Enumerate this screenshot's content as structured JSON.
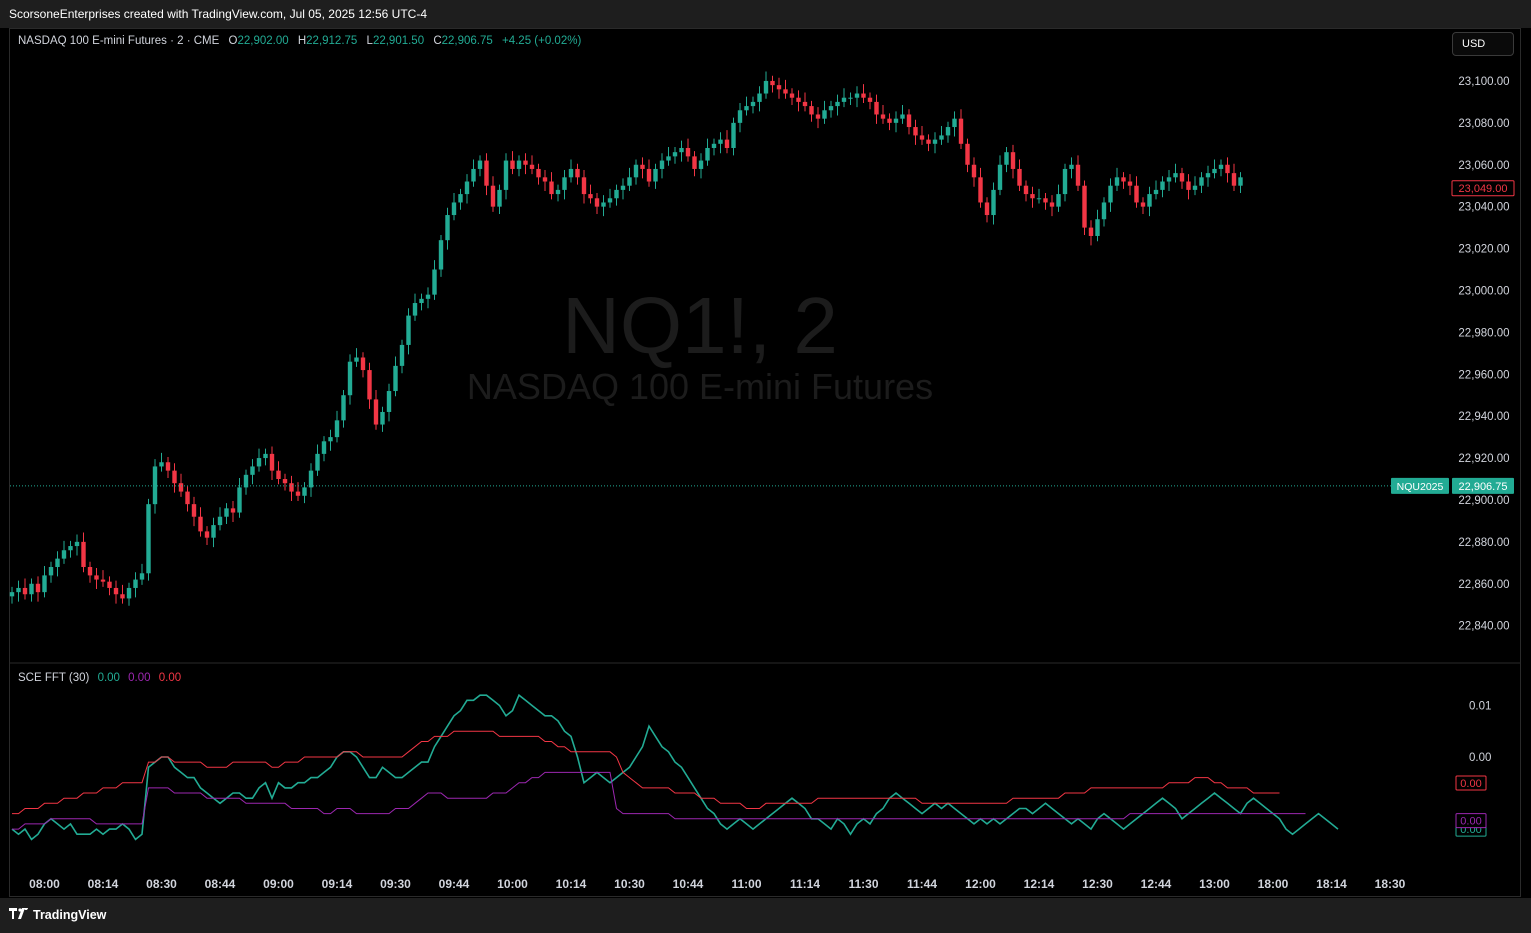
{
  "header": {
    "caption": "ScorsoneEnterprises created with TradingView.com, Jul 05, 2025 12:56 UTC-4"
  },
  "footer": {
    "brand": "TradingView"
  },
  "currency_button": "USD",
  "legend": {
    "symbol_desc": "NASDAQ 100 E-mini Futures · 2 · CME",
    "o_label": "O",
    "o": "22,902.00",
    "h_label": "H",
    "h": "22,912.75",
    "l_label": "L",
    "l": "22,901.50",
    "c_label": "C",
    "c": "22,906.75",
    "change": "+4.25 (+0.02%)"
  },
  "watermark": {
    "symbol": "NQ1!, 2",
    "name": "NASDAQ 100 E-mini Futures"
  },
  "indicator_legend": {
    "name": "SCE FFT (30)",
    "v1": "0.00",
    "v2": "0.00",
    "v3": "0.00"
  },
  "colors": {
    "up": "#22ab94",
    "down": "#f23645",
    "purple": "#9c27b0",
    "red_line": "#f23645",
    "teal_line": "#22ab94",
    "text": "#d1d4dc",
    "axis_text": "#d1d4dc"
  },
  "chart_data": [
    {
      "type": "candlestick",
      "title": "NASDAQ 100 E-mini Futures · 2 · CME",
      "y_ticks": [
        22840,
        22860,
        22880,
        22900,
        22920,
        22940,
        22960,
        22980,
        23000,
        23020,
        23040,
        23060,
        23080,
        23100
      ],
      "y_tick_labels": [
        "22,840.00",
        "22,860.00",
        "22,880.00",
        "22,900.00",
        "22,920.00",
        "22,940.00",
        "22,960.00",
        "22,980.00",
        "23,000.00",
        "23,020.00",
        "23,040.00",
        "23,060.00",
        "23,080.00",
        "23,100.00"
      ],
      "ylim": [
        22826,
        23110
      ],
      "x_tick_labels": [
        "08:00",
        "08:14",
        "08:30",
        "08:44",
        "09:00",
        "09:14",
        "09:30",
        "09:44",
        "10:00",
        "10:14",
        "10:30",
        "10:44",
        "11:00",
        "11:14",
        "11:30",
        "11:44",
        "12:00",
        "12:14",
        "12:30",
        "12:44",
        "13:00",
        "18:00",
        "18:14",
        "18:30"
      ],
      "x_tick_bar_index": [
        5,
        14,
        23,
        32,
        41,
        50,
        59,
        68,
        77,
        86,
        95,
        104,
        113,
        122,
        131,
        140,
        149,
        158,
        167,
        176,
        185,
        194,
        203,
        212
      ],
      "price_line": {
        "label": "NQU2025",
        "value": 22906.75,
        "value_label": "22,906.75"
      },
      "last_price": {
        "value": 23049.0,
        "value_label": "23,049.00"
      },
      "closes": [
        22856,
        22858,
        22855,
        22860,
        22856,
        22864,
        22868,
        22872,
        22876,
        22878,
        22880,
        22868,
        22864,
        22862,
        22861,
        22858,
        22855,
        22853,
        22858,
        22862,
        22865,
        22898,
        22916,
        22918,
        22914,
        22908,
        22904,
        22898,
        22892,
        22885,
        22882,
        22888,
        22892,
        22896,
        22894,
        22906,
        22912,
        22916,
        22920,
        22922,
        22914,
        22910,
        22908,
        22904,
        22902,
        22906,
        22914,
        22922,
        22928,
        22930,
        22938,
        22950,
        22966,
        22968,
        22962,
        22948,
        22936,
        22942,
        22952,
        22964,
        22974,
        22988,
        22994,
        22996,
        22998,
        23010,
        23024,
        23036,
        23042,
        23046,
        23052,
        23058,
        23062,
        23050,
        23040,
        23048,
        23062,
        23058,
        23062,
        23060,
        23058,
        23054,
        23052,
        23046,
        23048,
        23054,
        23058,
        23054,
        23046,
        23044,
        23040,
        23042,
        23044,
        23048,
        23050,
        23054,
        23060,
        23058,
        23052,
        23058,
        23062,
        23064,
        23066,
        23068,
        23064,
        23058,
        23062,
        23068,
        23070,
        23072,
        23068,
        23080,
        23086,
        23088,
        23090,
        23094,
        23100,
        23098,
        23096,
        23094,
        23092,
        23090,
        23088,
        23084,
        23082,
        23086,
        23088,
        23090,
        23092,
        23092,
        23094,
        23092,
        23090,
        23084,
        23082,
        23080,
        23082,
        23084,
        23078,
        23074,
        23072,
        23070,
        23072,
        23074,
        23078,
        23082,
        23070,
        23060,
        23054,
        23042,
        23036,
        23048,
        23060,
        23066,
        23058,
        23050,
        23046,
        23044,
        23044,
        23042,
        23040,
        23046,
        23058,
        23060,
        23050,
        23030,
        23026,
        23034,
        23042,
        23050,
        23054,
        23052,
        23050,
        23042,
        23040,
        23046,
        23048,
        23052,
        23054,
        23056,
        23052,
        23048,
        23050,
        23054,
        23056,
        23058,
        23060,
        23056,
        23050,
        23054
      ],
      "ohlc_note": "Closes of 2-minute candles read approximately from the chart",
      "y_axis_side": "right"
    },
    {
      "type": "line",
      "title": "SCE FFT (30)",
      "y_tick_labels": [
        "0.01",
        "0.00"
      ],
      "ylim": [
        -0.02,
        0.013
      ],
      "series": [
        {
          "color": "#22ab94",
          "values": [
            -0.014,
            -0.015,
            -0.014,
            -0.016,
            -0.015,
            -0.013,
            -0.012,
            -0.013,
            -0.014,
            -0.013,
            -0.015,
            -0.015,
            -0.015,
            -0.014,
            -0.015,
            -0.014,
            -0.014,
            -0.013,
            -0.014,
            -0.016,
            -0.015,
            -0.002,
            -0.001,
            0.0,
            0.0,
            -0.002,
            -0.003,
            -0.004,
            -0.004,
            -0.006,
            -0.007,
            -0.008,
            -0.009,
            -0.008,
            -0.007,
            -0.007,
            -0.008,
            -0.008,
            -0.006,
            -0.005,
            -0.008,
            -0.005,
            -0.006,
            -0.006,
            -0.005,
            -0.005,
            -0.004,
            -0.004,
            -0.003,
            -0.002,
            0.0,
            0.001,
            0.001,
            0.0,
            -0.002,
            -0.004,
            -0.004,
            -0.002,
            -0.003,
            -0.004,
            -0.004,
            -0.003,
            -0.002,
            -0.001,
            -0.001,
            0.002,
            0.004,
            0.006,
            0.008,
            0.009,
            0.011,
            0.011,
            0.012,
            0.012,
            0.011,
            0.01,
            0.008,
            0.009,
            0.012,
            0.011,
            0.01,
            0.009,
            0.008,
            0.008,
            0.007,
            0.005,
            0.004,
            0.0,
            -0.005,
            -0.004,
            -0.003,
            -0.004,
            -0.005,
            -0.004,
            -0.003,
            -0.002,
            0.0,
            0.002,
            0.006,
            0.004,
            0.002,
            0.001,
            -0.001,
            -0.002,
            -0.004,
            -0.006,
            -0.008,
            -0.01,
            -0.011,
            -0.013,
            -0.014,
            -0.013,
            -0.012,
            -0.013,
            -0.014,
            -0.013,
            -0.012,
            -0.011,
            -0.01,
            -0.009,
            -0.008,
            -0.009,
            -0.01,
            -0.012,
            -0.012,
            -0.013,
            -0.014,
            -0.012,
            -0.013,
            -0.015,
            -0.013,
            -0.012,
            -0.013,
            -0.011,
            -0.01,
            -0.008,
            -0.007,
            -0.008,
            -0.009,
            -0.01,
            -0.011,
            -0.01,
            -0.009,
            -0.01,
            -0.009,
            -0.01,
            -0.011,
            -0.012,
            -0.013,
            -0.012,
            -0.013,
            -0.012,
            -0.013,
            -0.012,
            -0.011,
            -0.01,
            -0.01,
            -0.011,
            -0.01,
            -0.009,
            -0.01,
            -0.011,
            -0.012,
            -0.013,
            -0.012,
            -0.013,
            -0.014,
            -0.012,
            -0.011,
            -0.012,
            -0.013,
            -0.014,
            -0.013,
            -0.012,
            -0.011,
            -0.01,
            -0.009,
            -0.008,
            -0.009,
            -0.01,
            -0.012,
            -0.011,
            -0.01,
            -0.009,
            -0.008,
            -0.007,
            -0.008,
            -0.009,
            -0.01,
            -0.011,
            -0.009,
            -0.008,
            -0.009,
            -0.01,
            -0.011,
            -0.012,
            -0.014,
            -0.015,
            -0.014,
            -0.013,
            -0.012,
            -0.011,
            -0.012,
            -0.013,
            -0.014
          ]
        },
        {
          "color": "#f23645",
          "values": [
            -0.011,
            -0.011,
            -0.01,
            -0.01,
            -0.01,
            -0.009,
            -0.009,
            -0.009,
            -0.008,
            -0.008,
            -0.008,
            -0.007,
            -0.007,
            -0.007,
            -0.006,
            -0.006,
            -0.006,
            -0.005,
            -0.005,
            -0.005,
            -0.005,
            -0.001,
            -0.001,
            0.0,
            0.0,
            -0.001,
            -0.001,
            -0.001,
            -0.001,
            -0.001,
            -0.002,
            -0.002,
            -0.002,
            -0.002,
            -0.001,
            -0.001,
            -0.001,
            -0.001,
            -0.001,
            -0.001,
            -0.002,
            -0.002,
            -0.001,
            -0.001,
            -0.001,
            0.0,
            0.0,
            0.0,
            0.0,
            0.0,
            0.0,
            0.001,
            0.001,
            0.001,
            0.0,
            0.0,
            0.0,
            0.0,
            0.0,
            0.0,
            0.0,
            0.001,
            0.002,
            0.003,
            0.003,
            0.004,
            0.004,
            0.004,
            0.005,
            0.005,
            0.005,
            0.005,
            0.005,
            0.005,
            0.005,
            0.004,
            0.004,
            0.004,
            0.004,
            0.004,
            0.004,
            0.004,
            0.003,
            0.003,
            0.002,
            0.002,
            0.001,
            0.001,
            0.001,
            0.001,
            0.001,
            0.001,
            0.001,
            0.0,
            -0.003,
            -0.004,
            -0.005,
            -0.006,
            -0.006,
            -0.006,
            -0.006,
            -0.006,
            -0.007,
            -0.007,
            -0.007,
            -0.007,
            -0.008,
            -0.008,
            -0.008,
            -0.009,
            -0.009,
            -0.009,
            -0.009,
            -0.01,
            -0.01,
            -0.01,
            -0.009,
            -0.009,
            -0.009,
            -0.009,
            -0.009,
            -0.009,
            -0.009,
            -0.009,
            -0.008,
            -0.008,
            -0.008,
            -0.008,
            -0.008,
            -0.008,
            -0.008,
            -0.008,
            -0.008,
            -0.008,
            -0.008,
            -0.008,
            -0.008,
            -0.008,
            -0.008,
            -0.008,
            -0.009,
            -0.009,
            -0.009,
            -0.009,
            -0.009,
            -0.009,
            -0.009,
            -0.009,
            -0.009,
            -0.009,
            -0.009,
            -0.009,
            -0.009,
            -0.009,
            -0.008,
            -0.008,
            -0.008,
            -0.008,
            -0.008,
            -0.008,
            -0.008,
            -0.008,
            -0.007,
            -0.007,
            -0.007,
            -0.007,
            -0.006,
            -0.006,
            -0.006,
            -0.006,
            -0.006,
            -0.006,
            -0.006,
            -0.006,
            -0.006,
            -0.006,
            -0.006,
            -0.006,
            -0.005,
            -0.005,
            -0.005,
            -0.005,
            -0.004,
            -0.004,
            -0.004,
            -0.005,
            -0.005,
            -0.006,
            -0.006,
            -0.006,
            -0.006,
            -0.007,
            -0.007,
            -0.007,
            -0.007,
            -0.007
          ]
        },
        {
          "color": "#9c27b0",
          "values": [
            -0.014,
            -0.014,
            -0.013,
            -0.013,
            -0.013,
            -0.013,
            -0.012,
            -0.012,
            -0.012,
            -0.012,
            -0.012,
            -0.012,
            -0.012,
            -0.013,
            -0.013,
            -0.013,
            -0.013,
            -0.013,
            -0.013,
            -0.013,
            -0.013,
            -0.006,
            -0.006,
            -0.006,
            -0.006,
            -0.007,
            -0.007,
            -0.007,
            -0.007,
            -0.007,
            -0.008,
            -0.008,
            -0.008,
            -0.008,
            -0.008,
            -0.008,
            -0.009,
            -0.009,
            -0.009,
            -0.009,
            -0.009,
            -0.009,
            -0.009,
            -0.01,
            -0.01,
            -0.01,
            -0.01,
            -0.01,
            -0.011,
            -0.011,
            -0.01,
            -0.01,
            -0.01,
            -0.011,
            -0.011,
            -0.011,
            -0.011,
            -0.011,
            -0.011,
            -0.01,
            -0.01,
            -0.01,
            -0.009,
            -0.008,
            -0.007,
            -0.007,
            -0.007,
            -0.008,
            -0.008,
            -0.008,
            -0.008,
            -0.008,
            -0.008,
            -0.008,
            -0.007,
            -0.007,
            -0.007,
            -0.006,
            -0.005,
            -0.005,
            -0.004,
            -0.004,
            -0.003,
            -0.003,
            -0.003,
            -0.003,
            -0.003,
            -0.003,
            -0.003,
            -0.003,
            -0.003,
            -0.003,
            -0.003,
            -0.01,
            -0.011,
            -0.011,
            -0.011,
            -0.011,
            -0.011,
            -0.011,
            -0.011,
            -0.011,
            -0.012,
            -0.012,
            -0.012,
            -0.012,
            -0.012,
            -0.012,
            -0.012,
            -0.012,
            -0.012,
            -0.012,
            -0.012,
            -0.012,
            -0.012,
            -0.012,
            -0.012,
            -0.012,
            -0.012,
            -0.012,
            -0.012,
            -0.012,
            -0.012,
            -0.012,
            -0.012,
            -0.012,
            -0.012,
            -0.012,
            -0.012,
            -0.012,
            -0.012,
            -0.012,
            -0.012,
            -0.012,
            -0.012,
            -0.012,
            -0.012,
            -0.012,
            -0.012,
            -0.012,
            -0.012,
            -0.012,
            -0.012,
            -0.012,
            -0.012,
            -0.012,
            -0.012,
            -0.012,
            -0.012,
            -0.012,
            -0.012,
            -0.012,
            -0.012,
            -0.012,
            -0.012,
            -0.012,
            -0.012,
            -0.012,
            -0.012,
            -0.012,
            -0.012,
            -0.012,
            -0.012,
            -0.012,
            -0.012,
            -0.012,
            -0.012,
            -0.012,
            -0.012,
            -0.012,
            -0.012,
            -0.012,
            -0.011,
            -0.011,
            -0.011,
            -0.011,
            -0.011,
            -0.011,
            -0.011,
            -0.011,
            -0.011,
            -0.011,
            -0.011,
            -0.011,
            -0.011,
            -0.011,
            -0.011,
            -0.011,
            -0.011,
            -0.011,
            -0.011,
            -0.011,
            -0.011,
            -0.011,
            -0.011,
            -0.011,
            -0.011,
            -0.011,
            -0.011,
            -0.011
          ]
        }
      ],
      "last_value_labels": [
        "0.00",
        "0.00",
        "0.00"
      ]
    }
  ]
}
